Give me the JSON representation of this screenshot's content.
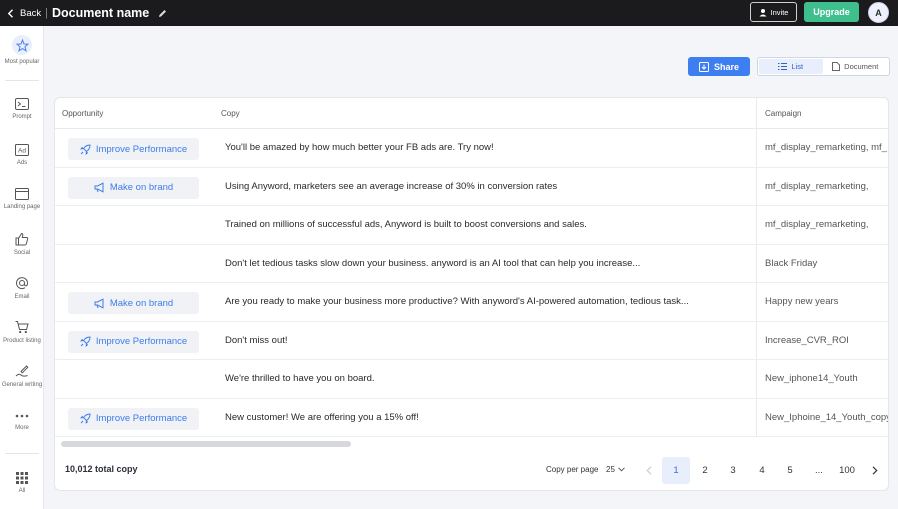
{
  "topbar": {
    "back_label": "Back",
    "separator": "|",
    "doc_title": "Document name",
    "invite_label": "Invite",
    "upgrade_label": "Upgrade",
    "avatar_initial": "A"
  },
  "sidebar": {
    "items": [
      {
        "label": "Most popular",
        "icon": "star-icon"
      },
      {
        "label": "Prompt",
        "icon": "terminal-icon"
      },
      {
        "label": "Ads",
        "icon": "ad-icon"
      },
      {
        "label": "Landing page",
        "icon": "browser-window-icon"
      },
      {
        "label": "Social",
        "icon": "thumbs-up-icon"
      },
      {
        "label": "Email",
        "icon": "at-sign-icon"
      },
      {
        "label": "Product listing",
        "icon": "cart-icon"
      },
      {
        "label": "General writing",
        "icon": "pen-icon"
      },
      {
        "label": "More",
        "icon": "more-dots-icon"
      },
      {
        "label": "All",
        "icon": "grid-icon"
      }
    ]
  },
  "actions": {
    "share_label": "Share",
    "view_list_label": "List",
    "view_document_label": "Document"
  },
  "table": {
    "headers": {
      "opportunity": "Opportunity",
      "copy": "Copy",
      "campaign": "Campaign"
    },
    "rows": [
      {
        "opportunity": "Improve Performance",
        "opp_icon": "rocket-icon",
        "copy": "You'll be amazed by how much better your FB ads are. Try now!",
        "campaign": "mf_display_remarketing, mf_"
      },
      {
        "opportunity": "Make on brand",
        "opp_icon": "megaphone-icon",
        "copy": "Using Anyword, marketers see an average increase of 30% in conversion rates",
        "campaign": "mf_display_remarketing,"
      },
      {
        "opportunity": "",
        "opp_icon": "",
        "copy": "Trained on millions of successful ads, Anyword is built to boost conversions and sales.",
        "campaign": "mf_display_remarketing,"
      },
      {
        "opportunity": "",
        "opp_icon": "",
        "copy": "Don't let tedious tasks slow down your business. anyword is an AI tool that can help you increase...",
        "campaign": "Black Friday"
      },
      {
        "opportunity": "Make on brand",
        "opp_icon": "megaphone-icon",
        "copy": "Are you ready to make your business more productive? With anyword's AI-powered automation, tedious task...",
        "campaign": "Happy new years"
      },
      {
        "opportunity": "Improve Performance",
        "opp_icon": "rocket-icon",
        "copy": "Don't miss out!",
        "campaign": "Increase_CVR_ROI"
      },
      {
        "opportunity": "",
        "opp_icon": "",
        "copy": "We're thrilled to have you on board.",
        "campaign": "New_iphone14_Youth"
      },
      {
        "opportunity": "Improve Performance",
        "opp_icon": "rocket-icon",
        "copy": "New customer! We are offering you a 15% off!",
        "campaign": "New_Iphoine_14_Youth_copy"
      }
    ]
  },
  "footer": {
    "total_label": "10,012 total copy",
    "per_page_label": "Copy per page",
    "per_page_value": "25",
    "pages": [
      "1",
      "2",
      "3",
      "4",
      "5",
      "...",
      "100"
    ],
    "current_page": "1"
  }
}
